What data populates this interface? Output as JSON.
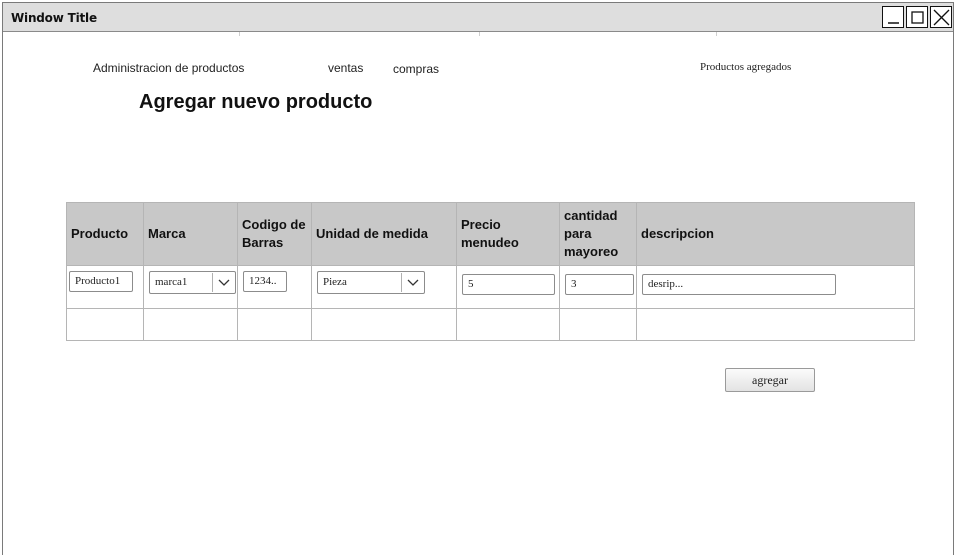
{
  "window": {
    "title": "Window Title",
    "controls": {
      "minimize": "minimize-icon",
      "maximize": "maximize-icon",
      "close": "close-icon"
    }
  },
  "nav": {
    "admin": "Administracion de productos",
    "ventas": "ventas",
    "compras": "compras",
    "agregados": "Productos agregados"
  },
  "page_title": "Agregar nuevo producto",
  "table": {
    "headers": {
      "producto": "Producto",
      "marca": "Marca",
      "codigo_line1": "Codigo de",
      "codigo_line2": "Barras",
      "unidad": "Unidad de medida",
      "precio_line1": "Precio",
      "precio_line2": "menudeo",
      "cantidad_line1": "cantidad",
      "cantidad_line2": "para",
      "cantidad_line3": "mayoreo",
      "descripcion": "descripcion"
    },
    "row1": {
      "producto": "Producto1",
      "marca": "marca1",
      "codigo": "1234..",
      "unidad": "Pieza",
      "precio": "5",
      "cantidad": "3",
      "descripcion": "desrip..."
    }
  },
  "agregar_button": "agregar",
  "colors": {
    "titlebar": "#dedede",
    "table_header": "#c8c8c8",
    "border": "#b5b5b5"
  }
}
